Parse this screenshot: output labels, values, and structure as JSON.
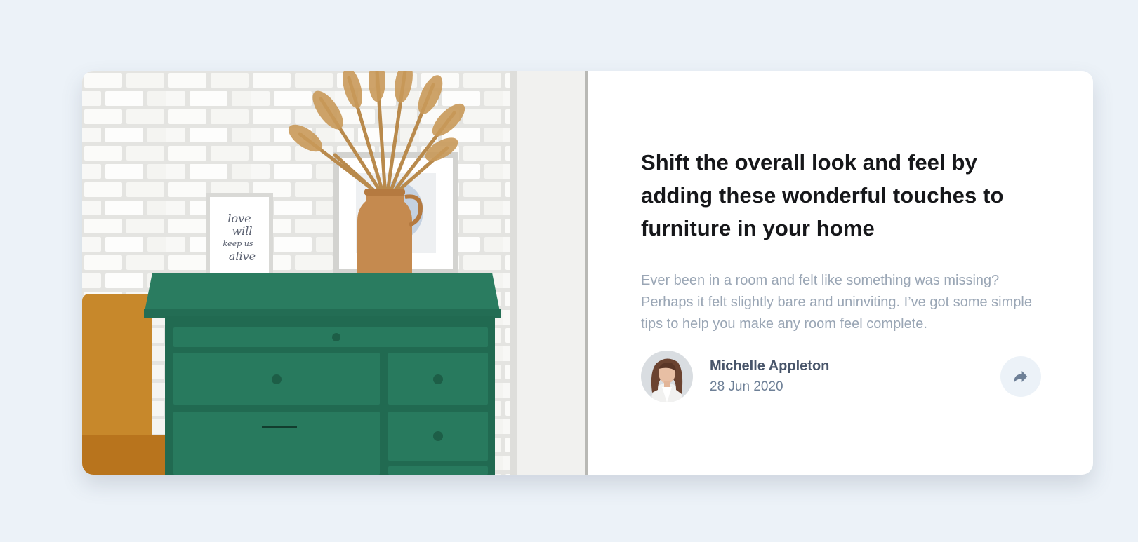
{
  "article": {
    "headline": "Shift the overall look and feel by adding these wonderful touches to furniture in your home",
    "excerpt": "Ever been in a room and felt like something was missing? Perhaps it felt slightly bare and uninviting. I’ve got some simple tips to help you make any room feel complete.",
    "image_alt": "Green dresser with a vase of dried grass and framed prints against a white brick wall"
  },
  "author": {
    "name": "Michelle Appleton",
    "date": "28 Jun 2020",
    "avatar_alt": "Michelle Appleton"
  },
  "share": {
    "icon": "share-arrow-icon",
    "label": "Share"
  },
  "colors": {
    "page_bg": "#ecf2f8",
    "card_bg": "#ffffff",
    "headline": "#16171a",
    "excerpt": "#9aa6b5",
    "author_name": "#48556a",
    "date": "#6e8097",
    "share_bg": "#ecf2f8",
    "share_icon": "#6e8097"
  }
}
